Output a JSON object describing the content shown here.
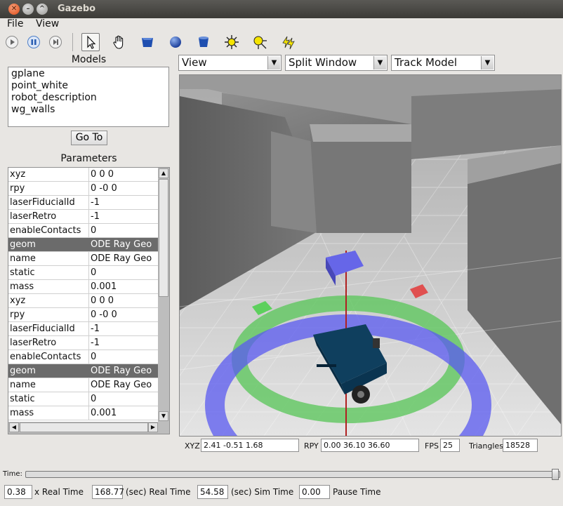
{
  "window": {
    "title": "Gazebo"
  },
  "menu": {
    "file": "File",
    "view": "View"
  },
  "toolbar": {
    "icons": [
      "play-icon",
      "pause-icon",
      "step-icon",
      "select-arrow-icon",
      "hand-icon",
      "box-icon",
      "sphere-icon",
      "cylinder-icon",
      "point-light-icon",
      "spot-light-icon",
      "directional-light-icon"
    ],
    "accent": "#1f4fb0"
  },
  "models": {
    "label": "Models",
    "items": [
      "gplane",
      "point_white",
      "robot_description",
      "wg_walls"
    ],
    "goto_label": "Go To"
  },
  "parameters": {
    "label": "Parameters",
    "rows": [
      {
        "key": "xyz",
        "value": "0 0 0"
      },
      {
        "key": "rpy",
        "value": "0 -0 0"
      },
      {
        "key": "laserFiducialId",
        "value": "-1"
      },
      {
        "key": "laserRetro",
        "value": "-1"
      },
      {
        "key": "enableContacts",
        "value": "0"
      },
      {
        "key": "geom",
        "value": "ODE Ray Geo",
        "highlight": true
      },
      {
        "key": "name",
        "value": "ODE Ray Geo"
      },
      {
        "key": "static",
        "value": "0"
      },
      {
        "key": "mass",
        "value": "0.001"
      },
      {
        "key": "xyz",
        "value": "0 0 0"
      },
      {
        "key": "rpy",
        "value": "0 -0 0"
      },
      {
        "key": "laserFiducialId",
        "value": "-1"
      },
      {
        "key": "laserRetro",
        "value": "-1"
      },
      {
        "key": "enableContacts",
        "value": "0"
      },
      {
        "key": "geom",
        "value": "ODE Ray Geo",
        "highlight": true
      },
      {
        "key": "name",
        "value": "ODE Ray Geo"
      },
      {
        "key": "static",
        "value": "0"
      },
      {
        "key": "mass",
        "value": "0.001"
      }
    ]
  },
  "viewport_controls": {
    "view": "View",
    "split": "Split Window",
    "track": "Track Model"
  },
  "status": {
    "xyz_label": "XYZ",
    "xyz": "2.41  -0.51  1.68",
    "rpy_label": "RPY",
    "rpy": "0.00  36.10  36.60",
    "fps_label": "FPS",
    "fps": "25",
    "tri_label": "Triangles",
    "triangles": "18528"
  },
  "time": {
    "label": "Time:"
  },
  "realtime": {
    "factor": "0.38",
    "factor_label": "x Real Time",
    "real": "168.77",
    "real_label": "(sec) Real Time",
    "sim": "54.58",
    "sim_label": "(sec) Sim Time",
    "pause": "0.00",
    "pause_label": "Pause Time"
  }
}
